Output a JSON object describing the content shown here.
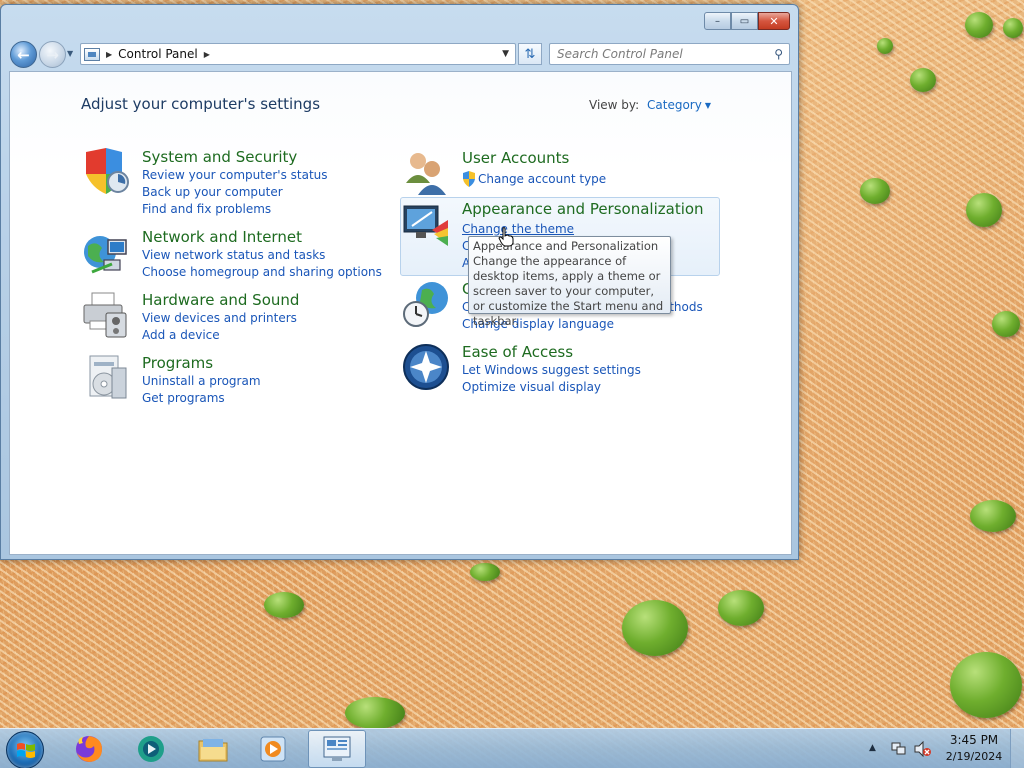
{
  "window": {
    "address_crumb": "Control Panel",
    "search_placeholder": "Search Control Panel",
    "caption": {
      "minimize": "–",
      "maximize": "▭",
      "close": "✕"
    }
  },
  "content": {
    "page_title": "Adjust your computer's settings",
    "view_by_label": "View by:",
    "view_by_value": "Category"
  },
  "categories": {
    "system": {
      "title": "System and Security",
      "links": [
        "Review your computer's status",
        "Back up your computer",
        "Find and fix problems"
      ]
    },
    "network": {
      "title": "Network and Internet",
      "links": [
        "View network status and tasks",
        "Choose homegroup and sharing options"
      ]
    },
    "hardware": {
      "title": "Hardware and Sound",
      "links": [
        "View devices and printers",
        "Add a device"
      ]
    },
    "programs": {
      "title": "Programs",
      "links": [
        "Uninstall a program",
        "Get programs"
      ]
    },
    "users": {
      "title": "User Accounts",
      "links": [
        "Change account type"
      ]
    },
    "appearance": {
      "title": "Appearance and Personalization",
      "links": [
        "Change the theme",
        "C",
        "A"
      ]
    },
    "clock": {
      "title": "C",
      "links": [
        "C",
        "Change display language"
      ],
      "link0_tail": "ut methods"
    },
    "ease": {
      "title": "Ease of Access",
      "links": [
        "Let Windows suggest settings",
        "Optimize visual display"
      ]
    }
  },
  "tooltip": {
    "title": "Appearance and Personalization",
    "body": "Change the appearance of desktop items, apply a theme or screen saver to your computer, or customize the Start menu and taskbar."
  },
  "taskbar": {
    "time": "3:45 PM",
    "date": "2/19/2024",
    "items": [
      "firefox-icon",
      "media-player-icon",
      "file-explorer-icon",
      "media-center-icon",
      "control-panel-icon"
    ]
  }
}
